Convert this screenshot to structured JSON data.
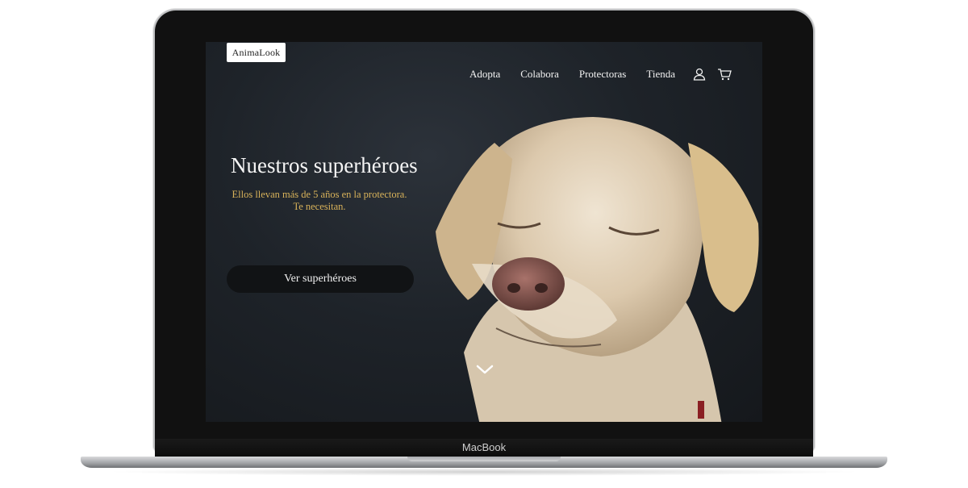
{
  "device": {
    "brand_label": "MacBook"
  },
  "site": {
    "logo_text": "AnimaLook",
    "nav": {
      "links": [
        "Adopta",
        "Colabora",
        "Protectoras",
        "Tienda"
      ],
      "icons": [
        "user-icon",
        "cart-icon"
      ]
    },
    "hero": {
      "title": "Nuestros superhéroes",
      "subtitle_line1": "Ellos llevan más de 5 años en la protectora.",
      "subtitle_line2": "Te necesitan.",
      "cta_label": "Ver superhéroes",
      "scroll_icon": "chevron-down-icon",
      "image": "labrador-dog-eyes-closed"
    },
    "colors": {
      "subtitle": "#d8b25a",
      "background": "#1e2329",
      "button": "#111315"
    }
  }
}
